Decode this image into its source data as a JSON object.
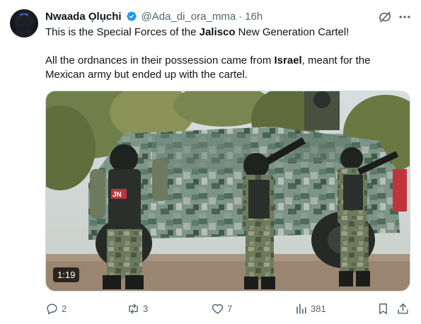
{
  "tweet": {
    "author_name": "Nwaada Ọlụchi",
    "handle": "@Ada_di_ora_mma",
    "separator": "·",
    "time": "16h",
    "line1_pre": "This is the Special Forces of the ",
    "line1_bold": "Jalisco",
    "line1_post": " New Generation Cartel!",
    "line2_pre": "All the ordnances in their possession came from ",
    "line2_bold": "Israel",
    "line2_post": ", meant for the",
    "line3": "Mexican army but ended up with the cartel."
  },
  "media": {
    "duration": "1:19",
    "patch_text": "JN"
  },
  "actions": {
    "replies": "2",
    "reposts": "3",
    "likes": "7",
    "views": "381"
  },
  "icons": {
    "verified": "verified-badge-icon",
    "grok": "grok-icon",
    "more": "more-icon",
    "reply": "reply-icon",
    "repost": "repost-icon",
    "like": "heart-icon",
    "views": "views-icon",
    "bookmark": "bookmark-icon",
    "share": "share-icon"
  },
  "colors": {
    "accent": "#1d9bf0",
    "secondary_text": "#536471",
    "primary_text": "#0f1419"
  }
}
